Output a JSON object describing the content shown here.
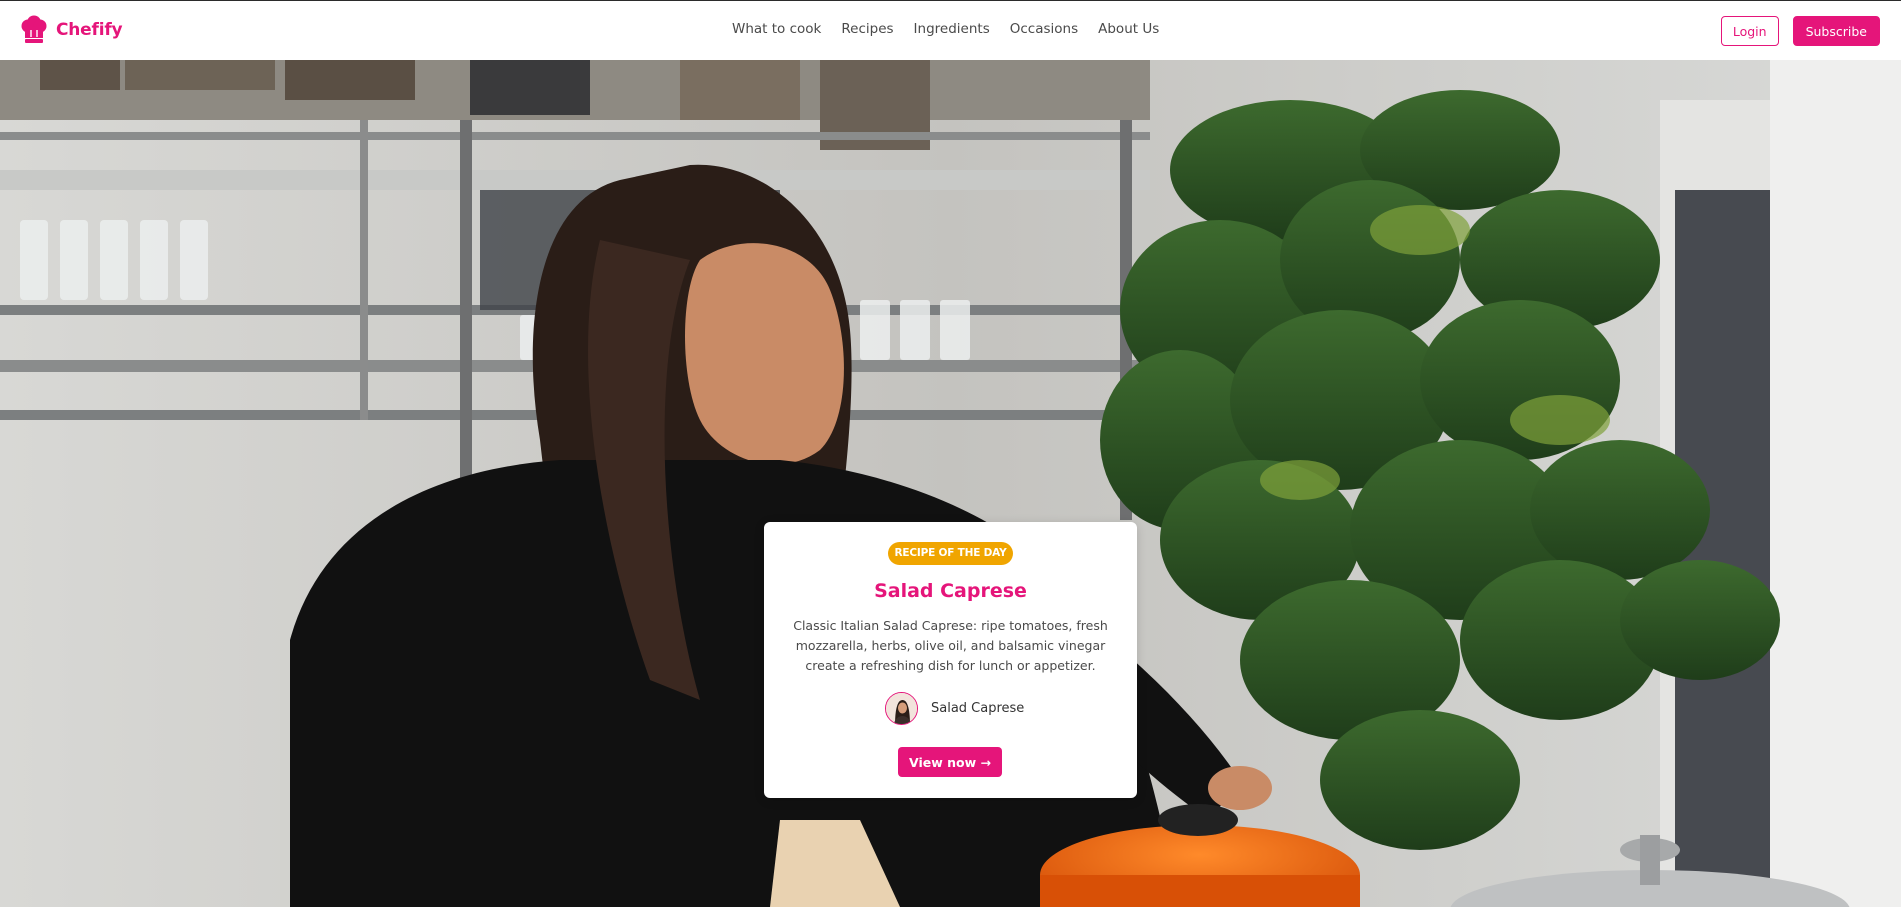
{
  "brand": {
    "name": "Chefify",
    "logo_icon": "chef-hat-icon",
    "accent_color": "#e5157a"
  },
  "nav": {
    "items": [
      {
        "label": "What to cook"
      },
      {
        "label": "Recipes"
      },
      {
        "label": "Ingredients"
      },
      {
        "label": "Occasions"
      },
      {
        "label": "About Us"
      }
    ]
  },
  "actions": {
    "login_label": "Login",
    "subscribe_label": "Subscribe"
  },
  "hero": {
    "image": "woman-cooking-in-kitchen-photo"
  },
  "card": {
    "badge": "RECIPE OF THE DAY",
    "badge_color": "#f0a500",
    "title": "Salad Caprese",
    "description": "Classic Italian Salad Caprese: ripe tomatoes, fresh mozzarella, herbs, olive oil, and balsamic vinegar create a refreshing dish for lunch or appetizer.",
    "author_name": "Salad Caprese",
    "button_label": "View now →"
  }
}
